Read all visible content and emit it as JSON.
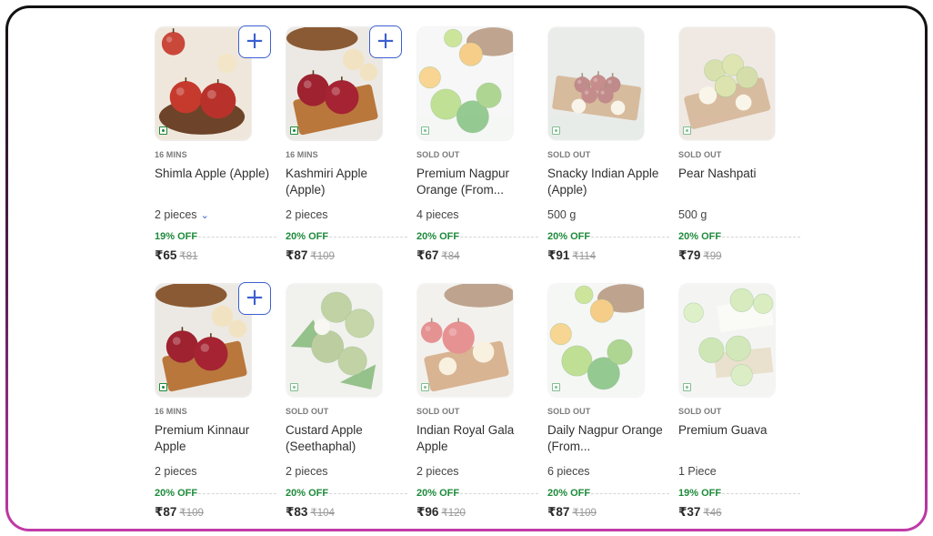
{
  "products": [
    {
      "badge": "16 MINS",
      "name": "Shimla Apple (Apple)",
      "qty": "2 pieces",
      "has_dropdown": true,
      "off": "19% OFF",
      "price": "₹65",
      "mrp": "₹81",
      "add_label": "+",
      "image": "apples-plate"
    },
    {
      "badge": "16 MINS",
      "name": "Kashmiri Apple (Apple)",
      "qty": "2 pieces",
      "off": "20% OFF",
      "price": "₹87",
      "mrp": "₹109",
      "add_label": "+",
      "image": "apples-board"
    },
    {
      "badge": "SOLD OUT",
      "name": "Premium Nagpur Orange (From...",
      "qty": "4 pieces",
      "off": "20% OFF",
      "price": "₹67",
      "mrp": "₹84",
      "image": "oranges"
    },
    {
      "badge": "SOLD OUT",
      "name": "Snacky Indian Apple (Apple)",
      "qty": "500 g",
      "off": "20% OFF",
      "price": "₹91",
      "mrp": "₹114",
      "image": "small-apples"
    },
    {
      "badge": "SOLD OUT",
      "name": "Pear Nashpati",
      "qty": "500 g",
      "off": "20% OFF",
      "price": "₹79",
      "mrp": "₹99",
      "image": "pears"
    },
    {
      "badge": "16 MINS",
      "name": "Premium Kinnaur Apple",
      "qty": "2 pieces",
      "off": "20% OFF",
      "price": "₹87",
      "mrp": "₹109",
      "add_label": "+",
      "image": "apples-board"
    },
    {
      "badge": "SOLD OUT",
      "name": "Custard Apple (Seethaphal)",
      "qty": "2 pieces",
      "off": "20% OFF",
      "price": "₹83",
      "mrp": "₹104",
      "image": "custard-apple"
    },
    {
      "badge": "SOLD OUT",
      "name": "Indian Royal Gala Apple",
      "qty": "2 pieces",
      "off": "20% OFF",
      "price": "₹96",
      "mrp": "₹120",
      "image": "gala"
    },
    {
      "badge": "SOLD OUT",
      "name": "Daily Nagpur Orange (From...",
      "qty": "6 pieces",
      "off": "20% OFF",
      "price": "₹87",
      "mrp": "₹109",
      "image": "oranges"
    },
    {
      "badge": "SOLD OUT",
      "name": "Premium Guava",
      "qty": "1 Piece",
      "off": "19% OFF",
      "price": "₹37",
      "mrp": "₹46",
      "image": "guava"
    }
  ],
  "icons": {
    "add": "plus-icon",
    "dropdown": "chevron-down-icon",
    "veg": "veg-mark-icon"
  },
  "colors": {
    "accent": "#3b5fd0",
    "discount": "#1d8a3a",
    "frame_top": "#111111",
    "frame_bottom": "#c23aa8"
  }
}
